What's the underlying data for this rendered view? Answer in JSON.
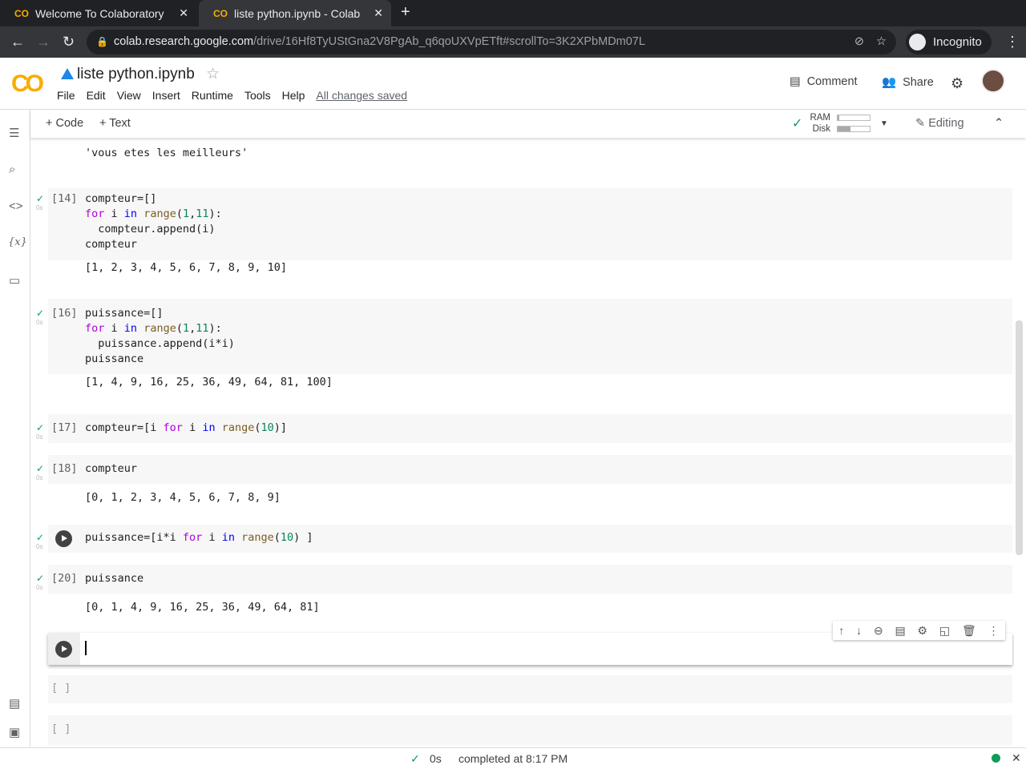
{
  "browser": {
    "tabs": [
      {
        "label": "Welcome To Colaboratory",
        "icon": "co-icon"
      },
      {
        "label": "liste python.ipynb - Colab",
        "icon": "co-icon"
      }
    ],
    "url_host": "colab.research.google.com",
    "url_path": "/drive/16Hf8TyUStGna2V8PgAb_q6qoUXVpETft#scrollTo=3K2XPbMDm07L",
    "profile": "Incognito"
  },
  "header": {
    "logo": "CO",
    "title": "liste python.ipynb",
    "menu": [
      "File",
      "Edit",
      "View",
      "Insert",
      "Runtime",
      "Tools",
      "Help"
    ],
    "saved": "All changes saved",
    "comment": "Comment",
    "share": "Share"
  },
  "toolbar": {
    "add_code": "+ Code",
    "add_text": "+ Text",
    "ram": "RAM",
    "disk": "Disk",
    "ram_usage": 0.05,
    "disk_usage": 0.4,
    "editing": "Editing"
  },
  "cells": [
    {
      "prompt": "",
      "output": "'vous etes les meilleurs'",
      "lines": []
    },
    {
      "prompt": "[14]",
      "lines": [
        [
          [
            "compteur=[]",
            ""
          ]
        ],
        [
          [
            "for",
            "kw"
          ],
          [
            " i ",
            ""
          ],
          [
            "in",
            "kb"
          ],
          [
            " ",
            ""
          ],
          [
            "range",
            "fn"
          ],
          [
            "(",
            ""
          ],
          [
            "1",
            "num"
          ],
          [
            ",",
            ""
          ],
          [
            "11",
            "num"
          ],
          [
            "):",
            ""
          ]
        ],
        [
          [
            "  compteur.append(i)",
            ""
          ]
        ],
        [
          [
            "compteur",
            ""
          ]
        ]
      ],
      "output": "[1, 2, 3, 4, 5, 6, 7, 8, 9, 10]"
    },
    {
      "prompt": "[16]",
      "lines": [
        [
          [
            "puissance=[]",
            ""
          ]
        ],
        [
          [
            "for",
            "kw"
          ],
          [
            " i ",
            ""
          ],
          [
            "in",
            "kb"
          ],
          [
            " ",
            ""
          ],
          [
            "range",
            "fn"
          ],
          [
            "(",
            ""
          ],
          [
            "1",
            "num"
          ],
          [
            ",",
            ""
          ],
          [
            "11",
            "num"
          ],
          [
            "):",
            ""
          ]
        ],
        [
          [
            "  puissance.append(i*i)",
            ""
          ]
        ],
        [
          [
            "puissance",
            ""
          ]
        ]
      ],
      "output": "[1, 4, 9, 16, 25, 36, 49, 64, 81, 100]"
    },
    {
      "prompt": "[17]",
      "lines": [
        [
          [
            "compteur=[i ",
            ""
          ],
          [
            "for",
            "kw"
          ],
          [
            " i ",
            ""
          ],
          [
            "in",
            "kb"
          ],
          [
            " ",
            ""
          ],
          [
            "range",
            "fn"
          ],
          [
            "(",
            ""
          ],
          [
            "10",
            "num"
          ],
          [
            ")]",
            ""
          ]
        ]
      ],
      "output": ""
    },
    {
      "prompt": "[18]",
      "lines": [
        [
          [
            "compteur",
            ""
          ]
        ]
      ],
      "output": "[0, 1, 2, 3, 4, 5, 6, 7, 8, 9]"
    },
    {
      "prompt": "",
      "lines": [
        [
          [
            "puissance=[i*i ",
            ""
          ],
          [
            "for",
            "kw"
          ],
          [
            " i ",
            ""
          ],
          [
            "in",
            "kb"
          ],
          [
            " ",
            ""
          ],
          [
            "range",
            "fn"
          ],
          [
            "(",
            ""
          ],
          [
            "10",
            "num"
          ],
          [
            ") ]",
            ""
          ]
        ]
      ],
      "output": ""
    },
    {
      "prompt": "[20]",
      "lines": [
        [
          [
            "puissance",
            ""
          ]
        ]
      ],
      "output": "[0, 1, 4, 9, 16, 25, 36, 49, 64, 81]"
    },
    {
      "prompt": "[ ]",
      "lines": [],
      "output": ""
    },
    {
      "prompt": "[ ]",
      "lines": [],
      "output": ""
    }
  ],
  "exec_time": "0s",
  "status": {
    "time": "0s",
    "text": "completed at 8:17 PM"
  }
}
